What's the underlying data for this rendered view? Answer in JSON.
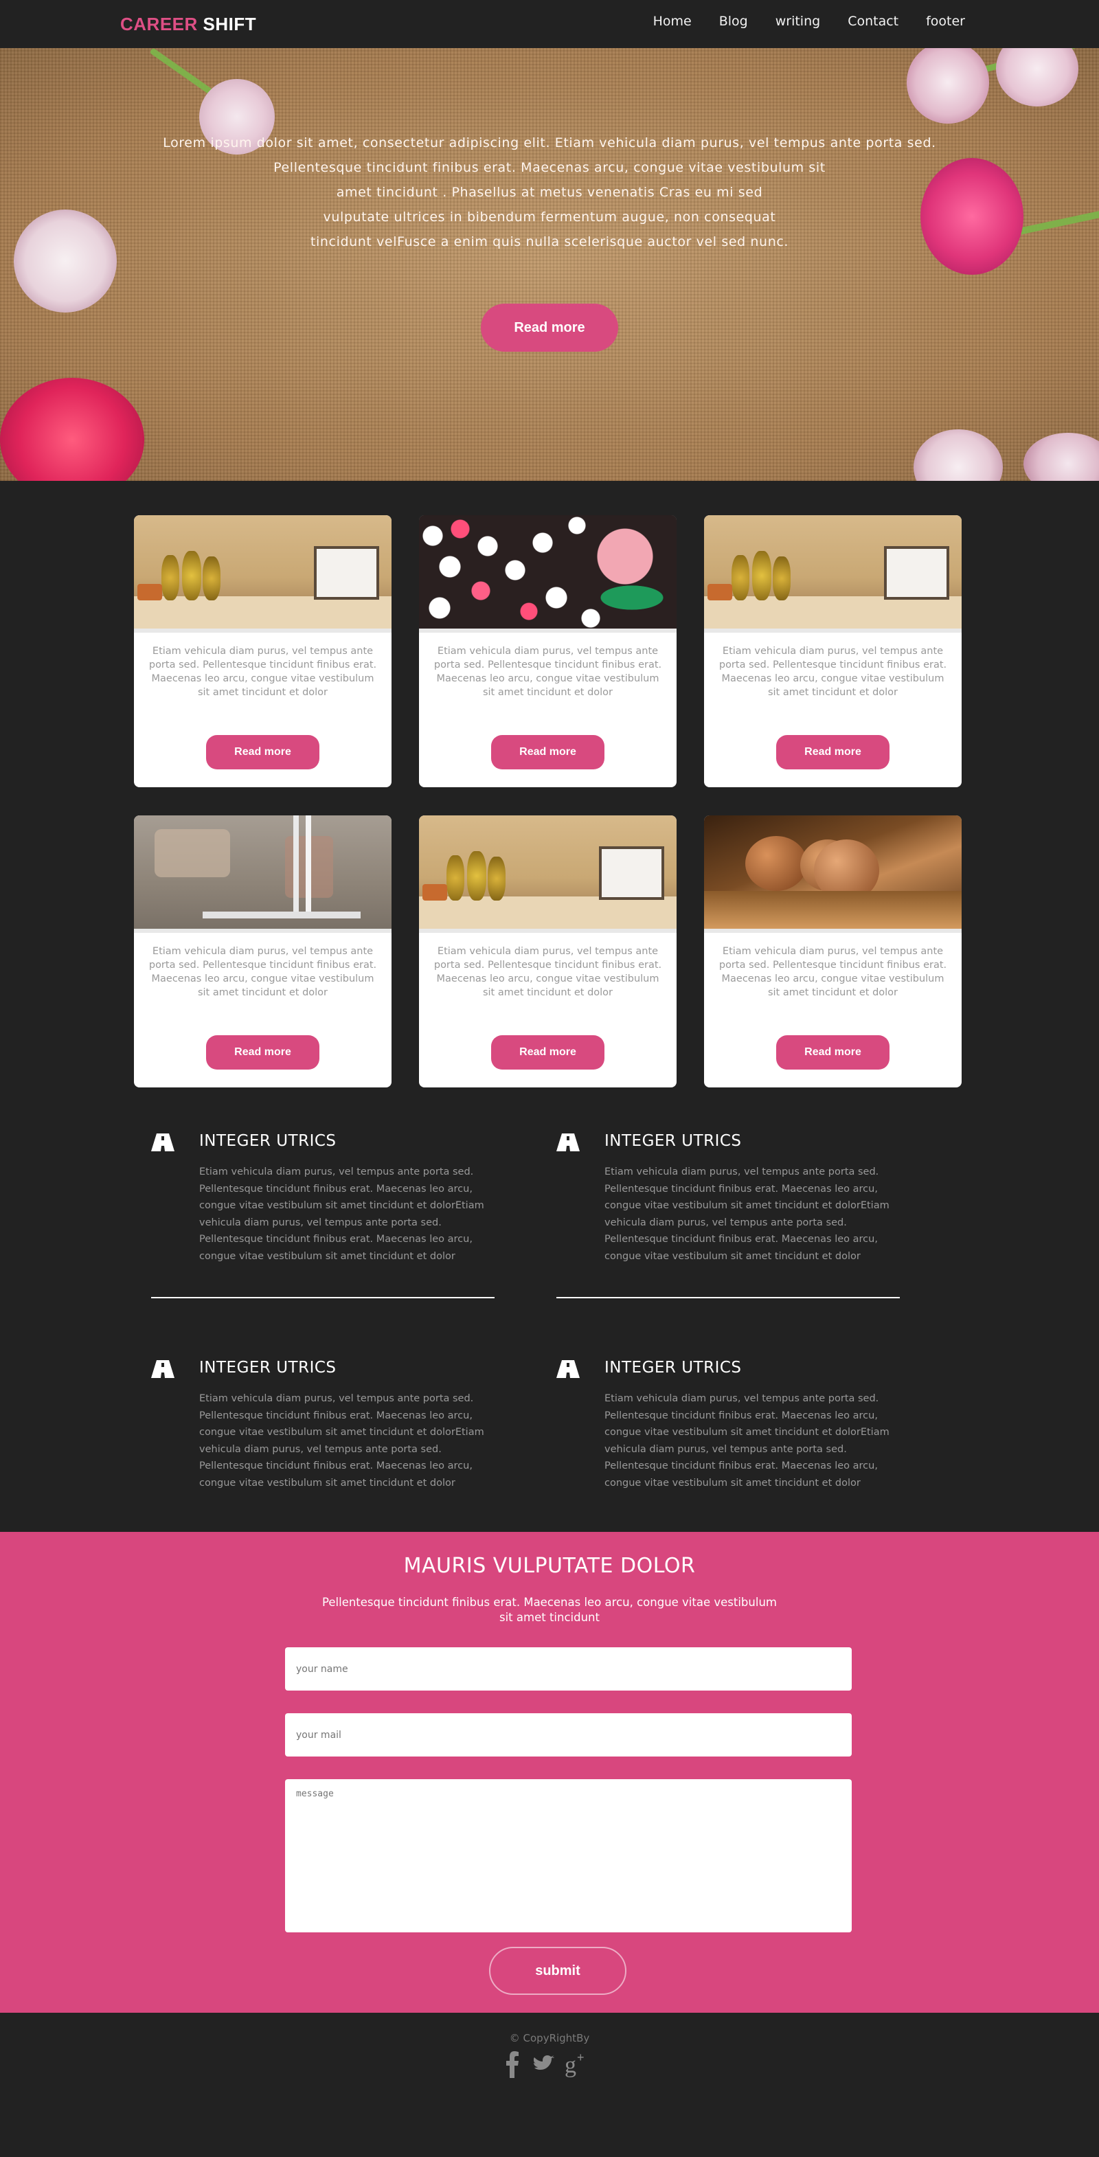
{
  "nav": {
    "brand_part1": "CAREER",
    "brand_part2": "SHIFT",
    "items": [
      {
        "label": "Home"
      },
      {
        "label": "Blog"
      },
      {
        "label": "writing"
      },
      {
        "label": "Contact"
      },
      {
        "label": "footer"
      }
    ]
  },
  "hero": {
    "lines": [
      "Lorem ipsum dolor sit amet, consectetur adipiscing elit. Etiam vehicula diam purus, vel tempus ante porta sed.",
      "Pellentesque tincidunt finibus erat. Maecenas arcu, congue vitae vestibulum sit",
      "amet tincidunt . Phasellus at metus venenatis Cras eu mi sed",
      "vulputate ultrices in bibendum fermentum augue, non consequat",
      "tincidunt velFusce a enim quis nulla scelerisque auctor vel sed nunc."
    ],
    "button_label": "Read more"
  },
  "cards": [
    {
      "image": "pineapples-shelf-image",
      "text": "Etiam vehicula diam purus, vel tempus ante porta sed. Pellentesque tincidunt finibus erat. Maecenas leo arcu, congue vitae vestibulum sit amet tincidunt et dolor",
      "button_label": "Read more"
    },
    {
      "image": "floating-flowers-image",
      "text": "Etiam vehicula diam purus, vel tempus ante porta sed. Pellentesque tincidunt finibus erat. Maecenas leo arcu, congue vitae vestibulum sit amet tincidunt et dolor",
      "button_label": "Read more"
    },
    {
      "image": "pineapples-shelf-image",
      "text": "Etiam vehicula diam purus, vel tempus ante porta sed. Pellentesque tincidunt finibus erat. Maecenas leo arcu, congue vitae vestibulum sit amet tincidunt et dolor",
      "button_label": "Read more"
    },
    {
      "image": "brick-wall-lamp-image",
      "text": "Etiam vehicula diam purus, vel tempus ante porta sed. Pellentesque tincidunt finibus erat. Maecenas leo arcu, congue vitae vestibulum sit amet tincidunt et dolor",
      "button_label": "Read more"
    },
    {
      "image": "pineapples-shelf-image",
      "text": "Etiam vehicula diam purus, vel tempus ante porta sed. Pellentesque tincidunt finibus erat. Maecenas leo arcu, congue vitae vestibulum sit amet tincidunt et dolor",
      "button_label": "Read more"
    },
    {
      "image": "wooden-balls-image",
      "text": "Etiam vehicula diam purus, vel tempus ante porta sed. Pellentesque tincidunt finibus erat. Maecenas leo arcu, congue vitae vestibulum sit amet tincidunt et dolor",
      "button_label": "Read more"
    }
  ],
  "features": [
    {
      "icon": "road-icon",
      "title": "INTEGER UTRICS",
      "text": "Etiam vehicula diam purus, vel tempus ante porta sed. Pellentesque tincidunt finibus erat. Maecenas leo arcu, congue vitae vestibulum sit amet tincidunt et dolorEtiam vehicula diam purus, vel tempus ante porta sed. Pellentesque tincidunt finibus erat. Maecenas leo arcu, congue vitae vestibulum sit amet tincidunt et dolor"
    },
    {
      "icon": "road-icon",
      "title": "INTEGER UTRICS",
      "text": "Etiam vehicula diam purus, vel tempus ante porta sed. Pellentesque tincidunt finibus erat. Maecenas leo arcu, congue vitae vestibulum sit amet tincidunt et dolorEtiam vehicula diam purus, vel tempus ante porta sed. Pellentesque tincidunt finibus erat. Maecenas leo arcu, congue vitae vestibulum sit amet tincidunt et dolor"
    },
    {
      "icon": "road-icon",
      "title": "INTEGER UTRICS",
      "text": "Etiam vehicula diam purus, vel tempus ante porta sed. Pellentesque tincidunt finibus erat. Maecenas leo arcu, congue vitae vestibulum sit amet tincidunt et dolorEtiam vehicula diam purus, vel tempus ante porta sed. Pellentesque tincidunt finibus erat. Maecenas leo arcu, congue vitae vestibulum sit amet tincidunt et dolor"
    },
    {
      "icon": "road-icon",
      "title": "INTEGER UTRICS",
      "text": "Etiam vehicula diam purus, vel tempus ante porta sed. Pellentesque tincidunt finibus erat. Maecenas leo arcu, congue vitae vestibulum sit amet tincidunt et dolorEtiam vehicula diam purus, vel tempus ante porta sed. Pellentesque tincidunt finibus erat. Maecenas leo arcu, congue vitae vestibulum sit amet tincidunt et dolor"
    }
  ],
  "contact": {
    "title": "MAURIS VULPUTATE DOLOR",
    "subtitle_line1": "Pellentesque tincidunt finibus erat. Maecenas leo arcu, congue vitae vestibulum",
    "subtitle_line2": "sit amet tincidunt",
    "name_placeholder": "your name",
    "mail_placeholder": "your mail",
    "message_placeholder": "message",
    "submit_label": "submit"
  },
  "footer": {
    "copyright": "© CopyRightBy",
    "social": [
      "facebook-icon",
      "twitter-icon",
      "google-plus-icon"
    ]
  },
  "colors": {
    "accent": "#d84a7f",
    "background": "#222222",
    "card": "#ffffff"
  }
}
